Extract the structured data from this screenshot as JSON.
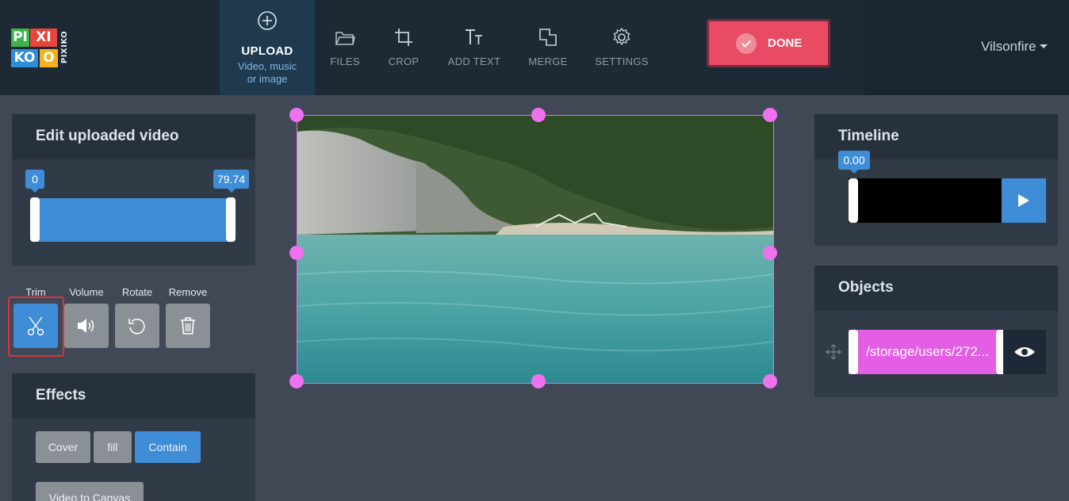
{
  "brand": {
    "logo_letters": [
      "PI",
      "XI",
      "KO",
      "O"
    ],
    "logo_vertical": "PIXIKO"
  },
  "toolbar": {
    "upload": {
      "label": "UPLOAD",
      "sub": "Video, music or image",
      "icon": "plus-circle-icon"
    },
    "items": [
      {
        "label": "FILES",
        "icon": "folder-icon"
      },
      {
        "label": "CROP",
        "icon": "crop-icon"
      },
      {
        "label": "ADD TEXT",
        "icon": "text-icon"
      },
      {
        "label": "MERGE",
        "icon": "merge-icon"
      },
      {
        "label": "SETTINGS",
        "icon": "gear-icon"
      }
    ],
    "done_label": "DONE"
  },
  "user": {
    "name": "Vilsonfire"
  },
  "edit_panel": {
    "title": "Edit uploaded video",
    "range_start": "0",
    "range_end": "79.74",
    "actions": [
      {
        "label": "Trim",
        "icon": "scissors-icon",
        "active": true
      },
      {
        "label": "Volume",
        "icon": "speaker-icon",
        "active": false
      },
      {
        "label": "Rotate",
        "icon": "rotate-icon",
        "active": false
      },
      {
        "label": "Remove",
        "icon": "trash-icon",
        "active": false
      }
    ]
  },
  "effects": {
    "title": "Effects",
    "buttons": [
      {
        "label": "Cover",
        "active": false
      },
      {
        "label": "fill",
        "active": false
      },
      {
        "label": "Contain",
        "active": true
      },
      {
        "label": "Video to Canvas",
        "active": false
      }
    ]
  },
  "timeline": {
    "title": "Timeline",
    "time": "0.00"
  },
  "objects": {
    "title": "Objects",
    "items": [
      {
        "path": "/storage/users/272..."
      }
    ]
  },
  "colors": {
    "accent": "#3f8dd6",
    "done": "#e84b63",
    "selection": "#ef6cf0",
    "object": "#e35ee4"
  }
}
